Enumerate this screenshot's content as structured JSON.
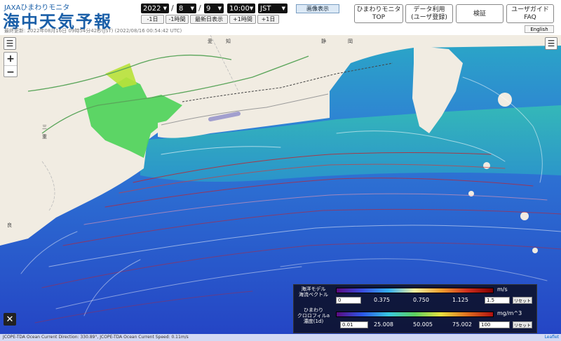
{
  "header": {
    "logo_sub": "JAXAひまわりモニタ",
    "logo_main": "海中天気予報",
    "updated": "最終更新: 2022年08月16日 09時54分42秒(JST) (2022/08/16 00:54:42 UTC)"
  },
  "time_controls": {
    "year": "2022",
    "month": "8",
    "day": "9",
    "time": "10:00",
    "timezone": "JST",
    "separator": "/",
    "buttons": {
      "minus_day": "-1日",
      "minus_hour": "-1時間",
      "latest": "最新日表示",
      "plus_hour": "+1時間",
      "plus_day": "+1日"
    }
  },
  "display_button": "画像表示",
  "nav": {
    "top_line1": "ひまわりモニタ",
    "top_line2": "TOP",
    "data_line1": "データ利用",
    "data_line2": "(ユーザ登録)",
    "verify": "検証",
    "guide_line1": "ユーザガイド",
    "guide_line2": "FAQ",
    "language": "English"
  },
  "map": {
    "places": [
      "愛",
      "知",
      "静",
      "岡",
      "三",
      "重",
      "良"
    ],
    "zoom_in": "+",
    "zoom_out": "−",
    "close": "✕"
  },
  "legend": {
    "current": {
      "title_line1": "海洋モデル",
      "title_line2": "海流ベクトル",
      "unit": "m/s",
      "min": "0",
      "max": "1.5",
      "ticks": [
        "0.375",
        "0.750",
        "1.125"
      ],
      "reset": "リセット"
    },
    "chlorophyll": {
      "title_line1": "ひまわり",
      "title_line2": "クロロフィルa",
      "title_line3": "濃度(1d)",
      "unit": "mg/m^3",
      "min": "0.01",
      "max": "100",
      "ticks": [
        "25.008",
        "50.005",
        "75.002"
      ],
      "reset": "リセット"
    }
  },
  "status": {
    "text": "JCOPE-TDA Ocean Current Direction: 330.89°, JCOPE-TDA Ocean Current Speed: 0.11m/s",
    "attribution": "Leaflet"
  },
  "colors": {
    "brand": "#1a5fa8",
    "ocean_deep": "#2a55cc",
    "ocean_shallow": "#2fa3c8",
    "bloom": "#54d454",
    "current_vector": "#c4202b"
  }
}
